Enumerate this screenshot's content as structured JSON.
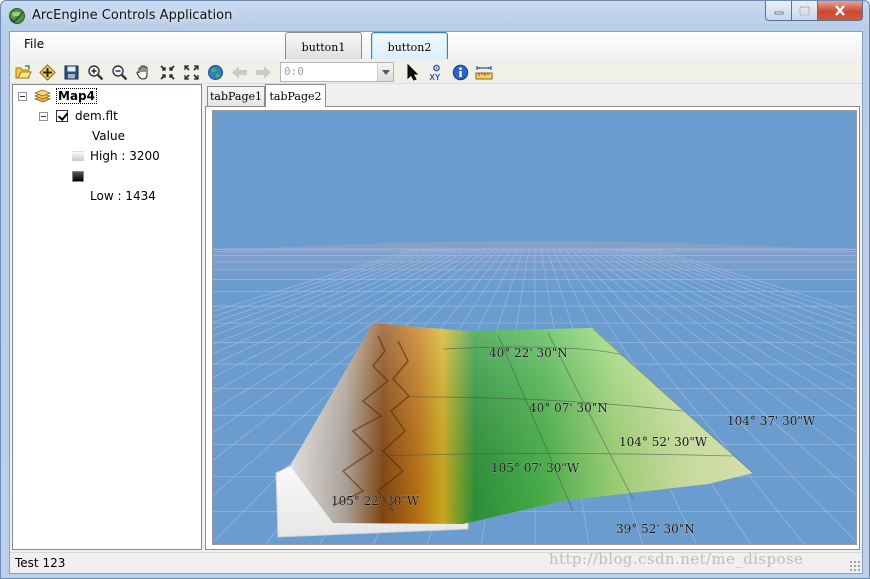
{
  "window": {
    "title": "ArcEngine Controls Application"
  },
  "menu": {
    "file_label": "File"
  },
  "buttons": {
    "button1_label": "button1",
    "button2_label": "button2"
  },
  "toolbar": {
    "combo_value": "0:0",
    "icons": [
      "open-icon",
      "add-data-icon",
      "save-icon",
      "zoom-in-icon",
      "zoom-out-icon",
      "pan-icon",
      "fixed-zoom-in-icon",
      "full-extent-icon",
      "globe-icon",
      "back-icon",
      "forward-icon",
      "select-arrow-icon",
      "xy-icon",
      "identify-icon",
      "measure-icon"
    ]
  },
  "toc": {
    "map_name": "Map4",
    "layer_name": "dem.flt",
    "legend_heading": "Value",
    "high_label": "High : 3200",
    "low_label": "Low : 1434"
  },
  "tabs": [
    {
      "label": "tabPage1",
      "active": false
    },
    {
      "label": "tabPage2",
      "active": true
    }
  ],
  "scene": {
    "sky_color": "#6a9ccf",
    "labels": [
      {
        "text": "40° 22' 30\"N"
      },
      {
        "text": "40° 07' 30\"N"
      },
      {
        "text": "104° 37' 30\"W"
      },
      {
        "text": "104° 52' 30\"W"
      },
      {
        "text": "105° 07' 30\"W"
      },
      {
        "text": "105° 22' 30\"W"
      },
      {
        "text": "39° 52' 30\"N"
      }
    ]
  },
  "status": {
    "text": "Test 123"
  },
  "watermark": "http://blog.csdn.net/me_dispose"
}
